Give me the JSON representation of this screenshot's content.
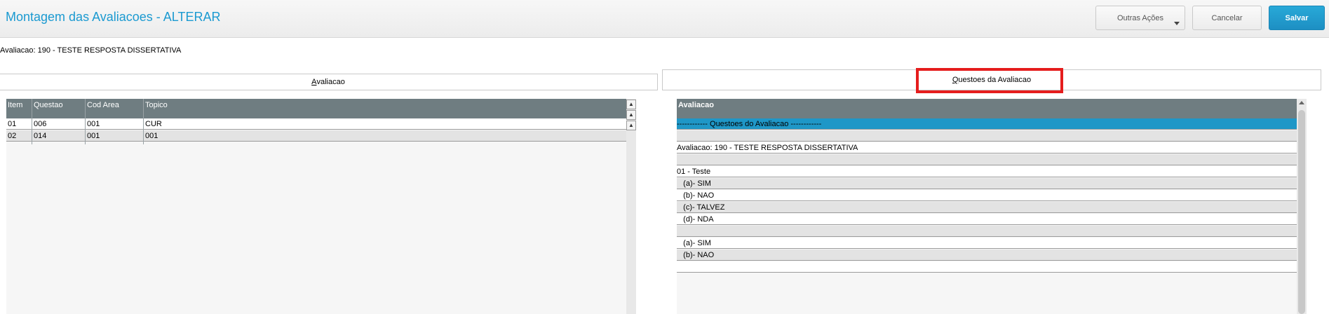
{
  "header": {
    "title": "Montagem das Avaliacoes - ALTERAR",
    "more_actions_label": "Outras Ações",
    "cancel_label": "Cancelar",
    "save_label": "Salvar"
  },
  "evaluation_label": "Avaliacao: 190 - TESTE RESPOSTA DISSERTATIVA",
  "tabs": {
    "left": {
      "accel": "A",
      "rest": "valiacao"
    },
    "right": {
      "accel": "Q",
      "rest": "uestoes da Avaliacao"
    }
  },
  "left_grid": {
    "columns": [
      "Item",
      "Questao",
      "Cod Area",
      "Topico"
    ],
    "rows": [
      [
        "01",
        "006",
        "001",
        "CUR"
      ],
      [
        "02",
        "014",
        "001",
        "001"
      ]
    ]
  },
  "right_grid": {
    "header": "Avaliacao",
    "rows": [
      "------------ Questoes do Avaliacao ------------",
      "",
      "Avaliacao: 190 - TESTE RESPOSTA DISSERTATIVA",
      "",
      "01 - Teste",
      "   (a)- SIM",
      "   (b)- NAO",
      "   (c)- TALVEZ",
      "   (d)- NDA",
      "",
      "   (a)- SIM",
      "   (b)- NAO",
      ""
    ]
  },
  "colors": {
    "accent": "#1b9ad1",
    "save_button": "#1d8fc3",
    "grid_header": "#6f7d81",
    "selected_row": "#1f97c7",
    "highlight_box": "#e51d1d"
  }
}
